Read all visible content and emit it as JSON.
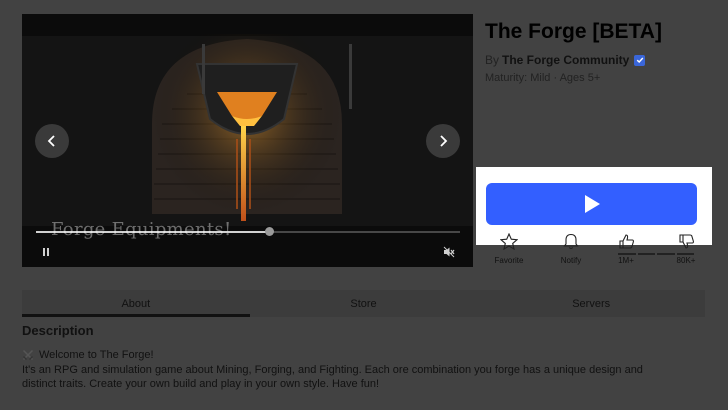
{
  "game": {
    "title": "The Forge [BETA]",
    "by_prefix": "By",
    "creator": "The Forge Community",
    "maturity": "Maturity: Mild · Ages 5+"
  },
  "media": {
    "caption": "Forge Equipments!",
    "progress": 0.55
  },
  "actions": {
    "favorite_label": "Favorite",
    "notify_label": "Notify",
    "upvotes": "1M+",
    "downvotes": "80K+"
  },
  "tabs": [
    {
      "label": "About",
      "active": true
    },
    {
      "label": "Store",
      "active": false
    },
    {
      "label": "Servers",
      "active": false
    }
  ],
  "description": {
    "heading": "Description",
    "welcome": "Welcome to The Forge!",
    "line1": "It's an RPG and simulation game about Mining, Forging, and Fighting. Each ore combination you forge has a unique design and",
    "line2": "distinct traits. Create your own build and play in your own style. Have fun!"
  },
  "colors": {
    "play_button": "#335fff",
    "verified_badge": "#3a66d9",
    "molten_metal": "#f5a623"
  },
  "icons": [
    "chevron-left-icon",
    "chevron-right-icon",
    "pause-icon",
    "mute-icon",
    "play-icon",
    "star-icon",
    "bell-icon",
    "thumbs-up-icon",
    "thumbs-down-icon",
    "verified-icon",
    "crossed-swords-icon"
  ]
}
